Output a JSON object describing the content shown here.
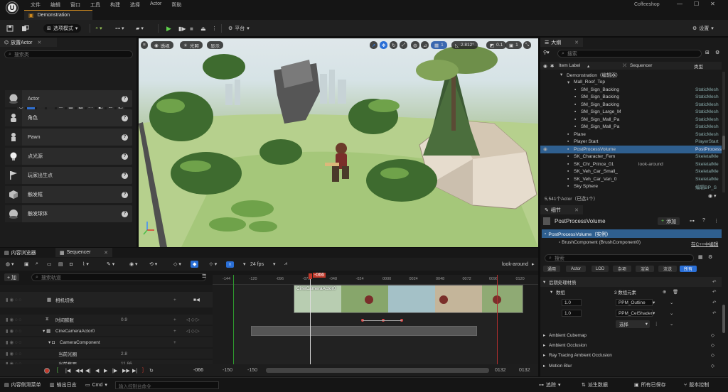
{
  "menubar": {
    "logo": "U",
    "menus": [
      "文件",
      "编辑",
      "窗口",
      "工具",
      "构建",
      "选择",
      "Actor",
      "帮助"
    ],
    "project_name": "Coffeeshop"
  },
  "level_tab": {
    "label": "Demonstration"
  },
  "toolbar": {
    "selection_mode": "选项模式",
    "platforms": "平台",
    "settings": "设置"
  },
  "place_actors": {
    "tab_label": "放置Actor",
    "search_placeholder": "搜索类",
    "category": "基础",
    "items": [
      {
        "label": "Actor",
        "icon": "sphere-icon"
      },
      {
        "label": "角色",
        "icon": "character-icon"
      },
      {
        "label": "Pawn",
        "icon": "pawn-icon"
      },
      {
        "label": "点光源",
        "icon": "lightbulb-icon"
      },
      {
        "label": "玩家出生点",
        "icon": "flag-icon"
      },
      {
        "label": "触发框",
        "icon": "cube-icon"
      },
      {
        "label": "触发球体",
        "icon": "sphere-icon"
      }
    ]
  },
  "viewport": {
    "perspective": "透视",
    "lit": "光照",
    "show": "显示",
    "fov": "2.812°",
    "speed": "0.1",
    "grid": "1",
    "cam": "1"
  },
  "outliner": {
    "tab_label": "大纲",
    "search_placeholder": "搜索",
    "col_label": "Item Label",
    "col_sequencer": "Sequencer",
    "col_type": "类型",
    "rows": [
      {
        "label": "Demonstration（编辑器）",
        "type": "",
        "seq": "",
        "indent": 1,
        "selected": false
      },
      {
        "label": "Mall_Roof_Top",
        "type": "",
        "seq": "",
        "indent": 2,
        "selected": false
      },
      {
        "label": "SM_Sign_Backing",
        "type": "StaticMesh",
        "seq": "",
        "indent": 3,
        "selected": false
      },
      {
        "label": "SM_Sign_Backing",
        "type": "StaticMesh",
        "seq": "",
        "indent": 3,
        "selected": false
      },
      {
        "label": "SM_Sign_Backing",
        "type": "StaticMesh",
        "seq": "",
        "indent": 3,
        "selected": false
      },
      {
        "label": "SM_Sign_Large_M",
        "type": "StaticMesh",
        "seq": "",
        "indent": 3,
        "selected": false
      },
      {
        "label": "SM_Sign_Mall_Pa",
        "type": "StaticMesh",
        "seq": "",
        "indent": 3,
        "selected": false
      },
      {
        "label": "SM_Sign_Mall_Pa",
        "type": "StaticMesh",
        "seq": "",
        "indent": 3,
        "selected": false
      },
      {
        "label": "Plane",
        "type": "StaticMesh",
        "seq": "",
        "indent": 2,
        "selected": false
      },
      {
        "label": "Player Start",
        "type": "PlayerStart",
        "seq": "",
        "indent": 2,
        "selected": false
      },
      {
        "label": "PostProcessVolume",
        "type": "PostProcess",
        "seq": "",
        "indent": 2,
        "selected": true
      },
      {
        "label": "SK_Character_Fem",
        "type": "SkeletalMe",
        "seq": "",
        "indent": 2,
        "selected": false
      },
      {
        "label": "SK_Chr_Prince_01",
        "type": "SkeletalMe",
        "seq": "look-around",
        "indent": 2,
        "selected": false
      },
      {
        "label": "SK_Veh_Car_Small_",
        "type": "SkeletalMe",
        "seq": "",
        "indent": 2,
        "selected": false
      },
      {
        "label": "SK_Veh_Car_Van_0",
        "type": "SkeletalMe",
        "seq": "",
        "indent": 2,
        "selected": false
      },
      {
        "label": "Sky Sphere",
        "type": "编辑BP_S",
        "seq": "",
        "indent": 2,
        "selected": false
      }
    ],
    "count": "5,541个Actor（已选1个）"
  },
  "details": {
    "tab_label": "细节",
    "title": "PostProcessVolume",
    "add_button": "添加",
    "instance_label": "PostProcessVolume（实例）",
    "component": "BrushComponent (BrushComponent0)",
    "edit_cpp": "在C++中编辑",
    "search_placeholder": "搜索",
    "filters": [
      "通用",
      "Actor",
      "LOD",
      "杂项",
      "渲染",
      "流送",
      "所有"
    ],
    "section": "后期处理材质",
    "array_label": "数组",
    "array_count": "3 数组元素",
    "elements": [
      {
        "weight": "1.0",
        "value": "PPM_Outline"
      },
      {
        "weight": "1.0",
        "value": "PPM_CelShader_I"
      }
    ],
    "select_label": "选择",
    "categories": [
      "Ambient Cubemap",
      "Ambient Occlusion",
      "Ray Tracing Ambient Occlusion",
      "Motion Blur"
    ]
  },
  "bottom": {
    "tab_content_browser": "内容浏览器",
    "tab_sequencer": "Sequencer",
    "fps": "24 fps",
    "sequence_name": "look-around",
    "add": "+ 加",
    "search_placeholder": "搜索轨道",
    "tracks": [
      {
        "label": "相机切换",
        "value": "",
        "indent": 0
      },
      {
        "label": "时间膨胀",
        "value": "0.9",
        "indent": 1
      },
      {
        "label": "CineCameraActor0",
        "value": "",
        "indent": 1
      },
      {
        "label": "CameraComponent",
        "value": "",
        "indent": 2
      },
      {
        "label": "当前光圈",
        "value": "2.8",
        "indent": 3
      },
      {
        "label": "当前焦距",
        "value": "11.86",
        "indent": 3
      }
    ],
    "playhead": "-066",
    "ruler": [
      "-144",
      "-120",
      "-096",
      "-072",
      "-048",
      "-024",
      "0000",
      "0024",
      "0048",
      "0072",
      "0096",
      "0120"
    ],
    "shot_label": "CineCameraActor0",
    "time_current": "-066",
    "range_start": "-150",
    "range_start2": "-150",
    "range_end": "0132",
    "range_end2": "0132"
  },
  "statusbar": {
    "content_drawer": "内容侧滑菜单",
    "output_log": "输出日志",
    "cmd": "Cmd",
    "cmd_placeholder": "输入控制台命令",
    "trace": "追踪",
    "derived_data": "派生数据",
    "all_saved": "所有已保存",
    "version_control": "版本控制"
  }
}
